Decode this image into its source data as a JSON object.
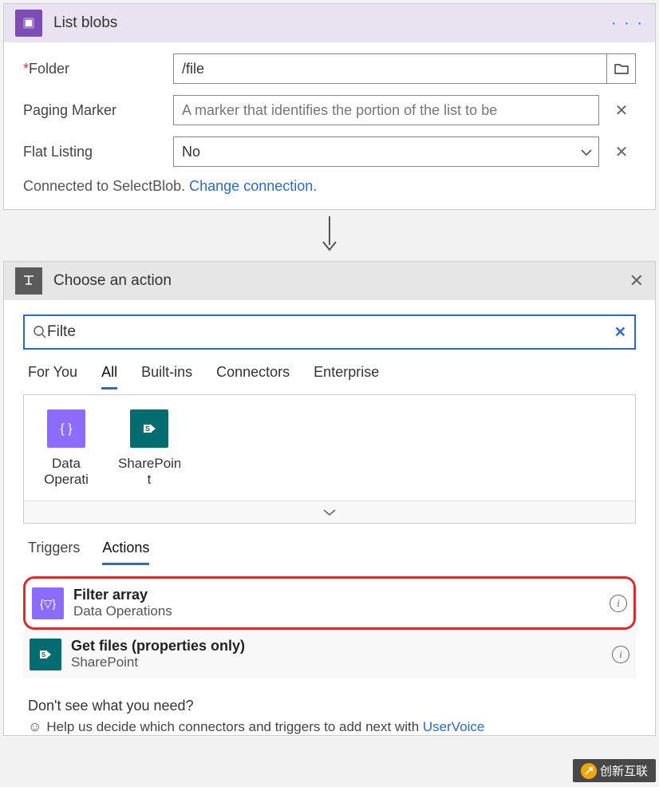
{
  "card1": {
    "title": "List blobs",
    "fields": {
      "folder": {
        "label": "Folder",
        "value": "/file",
        "required": true
      },
      "paging_marker": {
        "label": "Paging Marker",
        "placeholder": "A marker that identifies the portion of the list to be"
      },
      "flat_listing": {
        "label": "Flat Listing",
        "value": "No"
      }
    },
    "connection": {
      "text": "Connected to SelectBlob.  ",
      "link": "Change connection."
    }
  },
  "card2": {
    "title": "Choose an action",
    "search_value": "Filte",
    "tabs": [
      "For You",
      "All",
      "Built-ins",
      "Connectors",
      "Enterprise"
    ],
    "tabs_active": "All",
    "connectors": [
      {
        "name": "Data Operati",
        "icon": "data-ops"
      },
      {
        "name": "SharePoin t",
        "icon": "sharepoint"
      }
    ],
    "sub_tabs": [
      "Triggers",
      "Actions"
    ],
    "sub_tabs_active": "Actions",
    "actions": [
      {
        "title": "Filter array",
        "sub": "Data Operations",
        "icon": "data-ops",
        "highlighted": true
      },
      {
        "title": "Get files (properties only)",
        "sub": "SharePoint",
        "icon": "sharepoint",
        "highlighted": false
      }
    ],
    "footer": {
      "q": "Don't see what you need?",
      "line": "Help us decide which connectors and triggers to add next with ",
      "link": "UserVoice"
    }
  },
  "watermark": "创新互联"
}
